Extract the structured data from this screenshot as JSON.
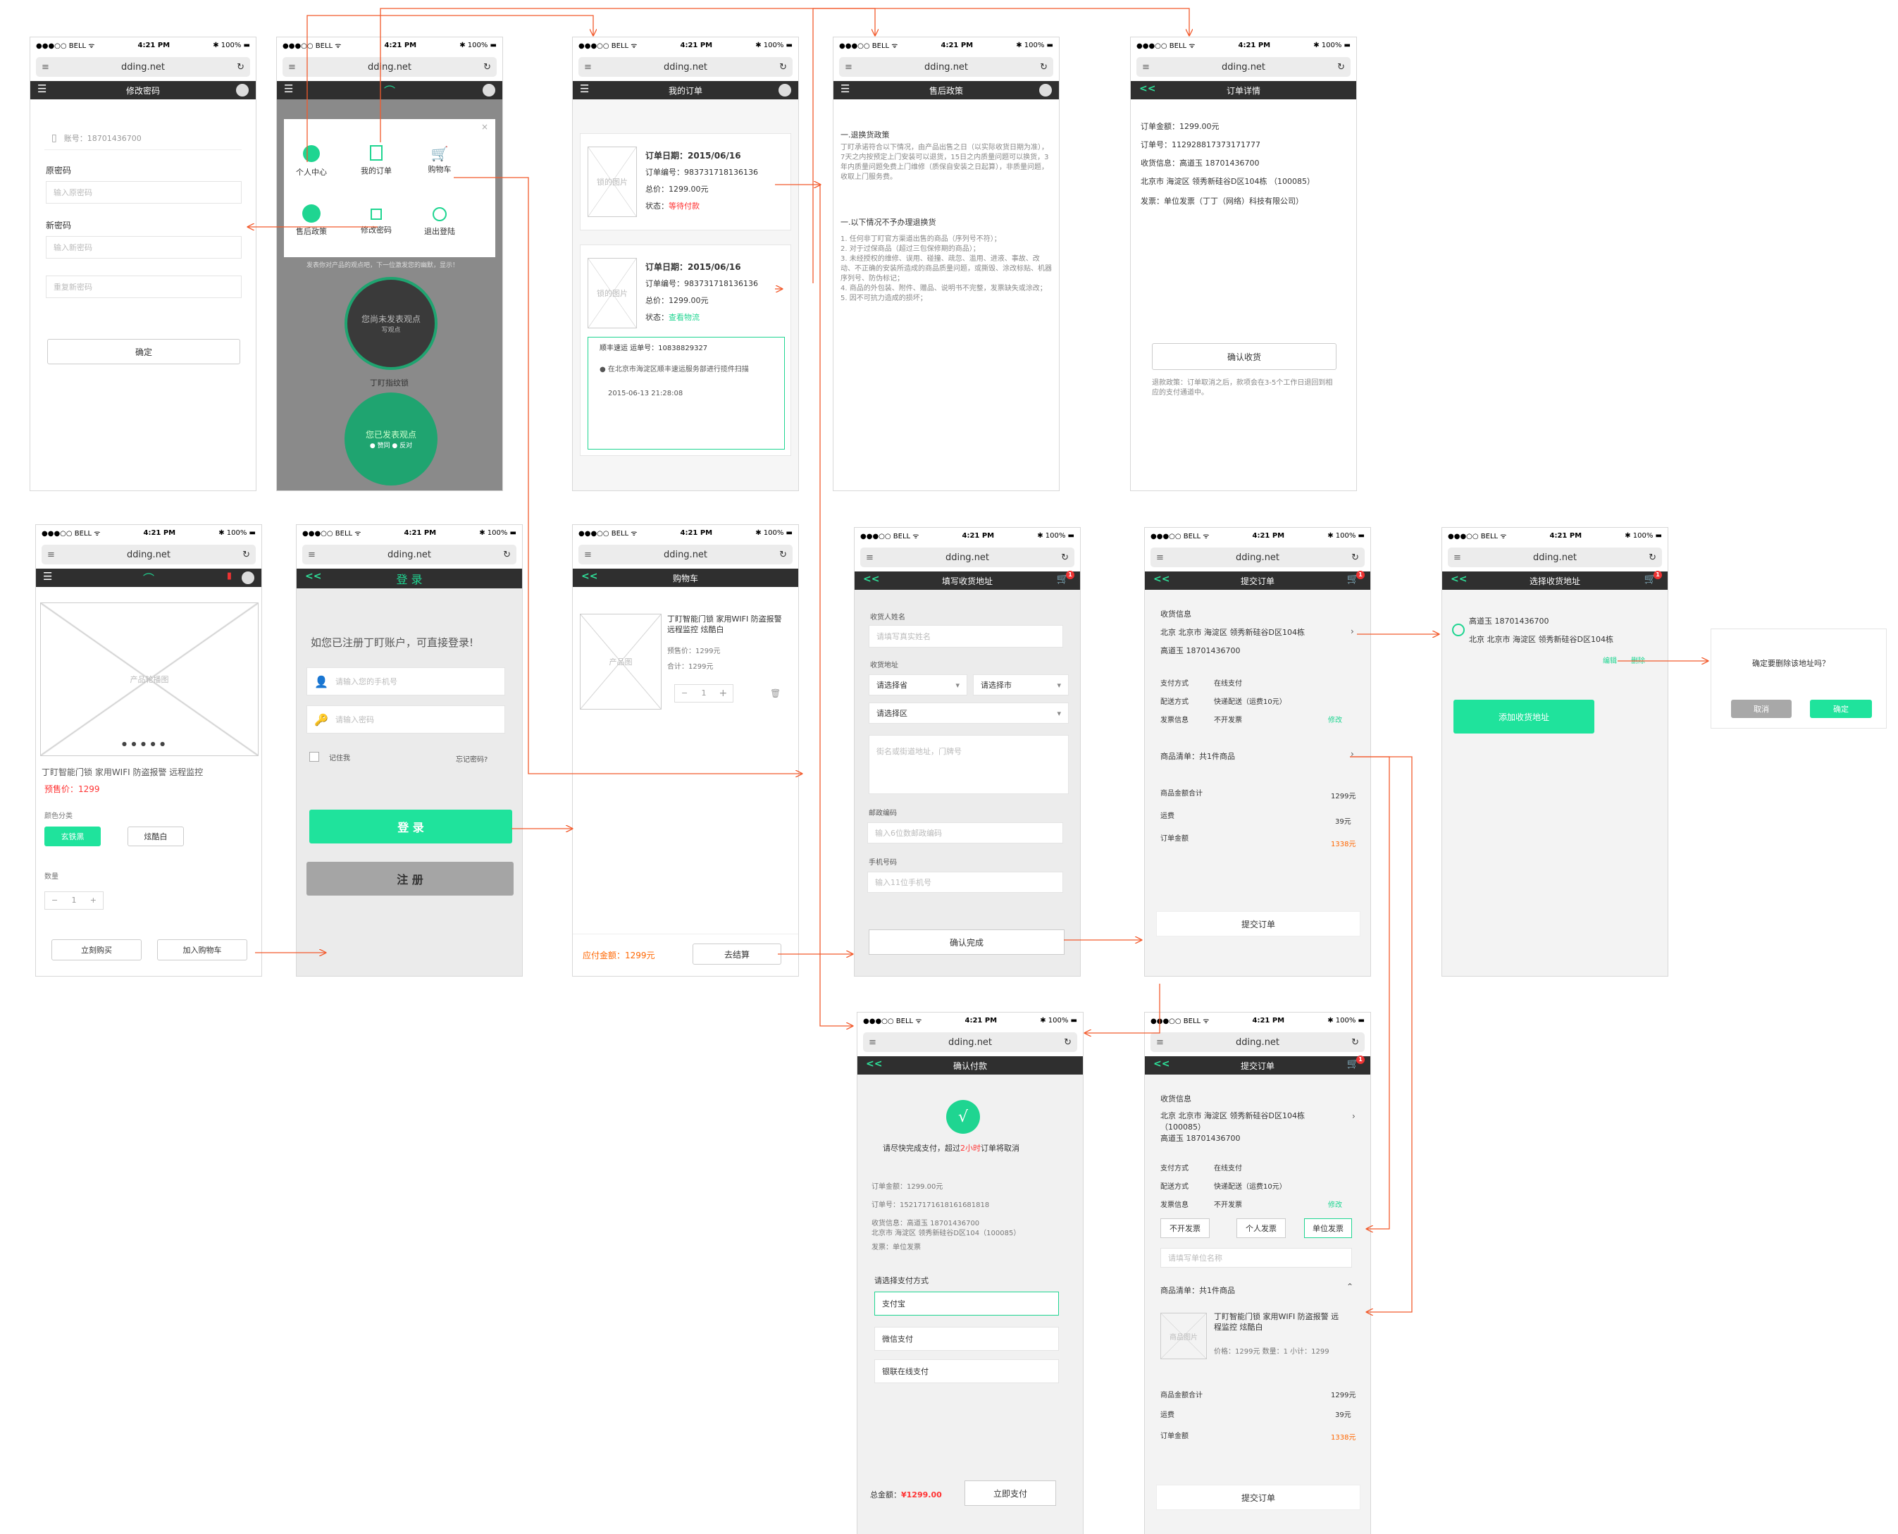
{
  "common": {
    "carrier": "●●●○○ BELL ᯤ",
    "time": "4:21 PM",
    "battery": "✱ 100% ▬",
    "url": "dding.net",
    "menu": "☰",
    "back": "<<",
    "cart_count": "1"
  },
  "s1": {
    "title": "修改密码",
    "account": "账号：18701436700",
    "old": "原密码",
    "old_ph": "输入原密码",
    "new": "新密码",
    "new_ph": "输入新密码",
    "repeat_ph": "重复新密码",
    "ok": "确定"
  },
  "s2": {
    "menu": [
      "个人中心",
      "我的订单",
      "购物车",
      "售后政策",
      "修改密码",
      "退出登陆"
    ],
    "close": "×",
    "note": "发表你对产品的观点吧，下一位激发您的幽默，显示！",
    "bubble1": "您尚未发表观点",
    "bubble1b": "写观点",
    "product": "丁盯指纹锁",
    "bubble2": "您已发表观点",
    "bubble2b": "● 赞同 ● 反对"
  },
  "s3": {
    "title": "我的订单",
    "o1_date": "订单日期：2015/06/16",
    "o1_no": "订单编号：983731718136136",
    "o1_total": "总价：1299.00元",
    "o1_status_l": "状态：",
    "o1_status": "等待付款",
    "img": "锁的图片",
    "o2_date": "订单日期：2015/06/16",
    "o2_no": "订单编号：983731718136136",
    "o2_total": "总价：1299.00元",
    "o2_status_l": "状态：",
    "o2_status": "查看物流",
    "ship": "顺丰速运  运单号：10838829327",
    "ship_msg": "● 在北京市海淀区顺丰速运服务部进行揽件扫描",
    "ship_time": "2015-06-13  21:28:08"
  },
  "s4": {
    "title": "售后政策",
    "h1": "一.退换货政策",
    "p1": "丁盯承诺符合以下情况，由产品出售之日（以实际收货日期为准），7天之内按预定上门安装可以退货，15日之内质量问题可以换货，3年内质量问题免费上门维修（质保自安装之日起算），非质量问题，收取上门服务费。",
    "h2": "一.以下情况不予办理退换货",
    "p2": "1. 任何非丁盯官方渠道出售的商品（序列号不符）；\n2. 对于过保商品（超过三包保修期的商品）；\n3. 未经授权的维修、误用、碰撞、疏忽、滥用、进液、事故、改动、不正确的安装所造成的商品质量问题，或撕毁、涂改标贴、机器序列号、防伪标记；\n4. 商品的外包装、附件、赠品、说明书不完整，发票缺失或涂改；\n5. 因不可抗力造成的损坏；"
  },
  "s5": {
    "title": "订单详情",
    "amount": "订单金额：1299.00元",
    "no": "订单号：112928817373171777",
    "recv": "收货信息：高道玉  18701436700",
    "addr": "北京市 海淀区 领秀新硅谷D区104栋 （100085）",
    "invoice": "发票：单位发票（丁丁（网络）科技有限公司）",
    "confirm": "确认收货",
    "refund": "退款政策：订单取消之后，款项会在3-5个工作日退回到相应的支付通道中。"
  },
  "s6": {
    "carousel": "产品轮播图",
    "dots": "● ● ● ● ●",
    "name": "丁盯智能门锁  家用WIFI  防盗报警 远程监控",
    "price": "预售价：1299",
    "color": "颜色分类",
    "c1": "玄铁黑",
    "c2": "炫酷白",
    "qty": "数量",
    "minus": "−",
    "one": "1",
    "plus": "+",
    "buy": "立刻购买",
    "add": "加入购物车"
  },
  "s7": {
    "title": "登  录",
    "tip": "如您已注册丁盯账户，可直接登录!",
    "phone_ph": "请输入您的手机号",
    "pwd_ph": "请输入密码",
    "remember": "记住我",
    "forgot": "忘记密码?",
    "login": "登  录",
    "register": "注  册"
  },
  "s8": {
    "title": "购物车",
    "img": "产品图",
    "name": "丁盯智能门锁  家用WIFI  防盗报警 远程监控   炫酷白",
    "pre": "预售价：1299元",
    "sum": "合计：1299元",
    "minus": "−",
    "one": "1",
    "plus": "+",
    "del": "🗑",
    "pay_l": "应付金额：1299元",
    "checkout": "去结算"
  },
  "s9": {
    "title": "填写收货地址",
    "name": "收货人姓名",
    "name_ph": "请填写真实姓名",
    "addr": "收货地址",
    "prov": "请选择省",
    "city": "请选择市",
    "dist": "请选择区",
    "street_ph": "街名或街道地址，门牌号",
    "zip": "邮政编码",
    "zip_ph": "输入6位数邮政编码",
    "phone": "手机号码",
    "phone_ph": "输入11位手机号",
    "done": "确认完成"
  },
  "s10": {
    "title": "提交订单",
    "recv": "收货信息",
    "addr": "北京 北京市 海淀区  领秀新硅谷D区104栋",
    "person": "高道玉   18701436700",
    "pay": "支付方式",
    "pay_v": "在线支付",
    "ship": "配送方式",
    "ship_v": "快递配送（运费10元）",
    "inv": "发票信息",
    "inv_v": "不开发票",
    "edit": "修改",
    "list": "商品清单：共1件商品",
    "goods": "商品金额合计",
    "goods_v": "1299元",
    "fee": "运费",
    "fee_v": "39元",
    "total": "订单金额",
    "total_v": "1338元",
    "submit": "提交订单"
  },
  "s11": {
    "title": "选择收货地址",
    "person": "高道玉    18701436700",
    "addr": "北京 北京市 海淀区 领秀新硅谷D区104栋",
    "edit": "编辑",
    "del": "删除",
    "add": "添加收货地址"
  },
  "dlg": {
    "q": "确定要删除该地址吗？",
    "cancel": "取消",
    "ok": "确定"
  },
  "s12": {
    "title": "确认付款",
    "check": "√",
    "tip_a": "请尽快完成支付，超过",
    "tip_b": "2小时",
    "tip_c": "订单将取消",
    "amount": "订单金额：1299.00元",
    "no": "订单号：15217171618161681818",
    "recv": "收货信息：高道玉 18701436700",
    "addr": "北京市 海淀区 领秀新硅谷D区104（100085）",
    "inv": "发票：单位发票",
    "choose": "请选择支付方式",
    "ali": "支付宝",
    "wx": "微信支付",
    "union": "银联在线支付",
    "total_l": "总金额：",
    "total_v": "¥1299.00",
    "pay": "立即支付"
  },
  "s13": {
    "title": "提交订单",
    "recv": "收货信息",
    "addr": "北京 北京市 海淀区  领秀新硅谷D区104栋",
    "zip": "（100085）",
    "person": "高道玉   18701436700",
    "pay": "支付方式",
    "pay_v": "在线支付",
    "ship": "配送方式",
    "ship_v": "快递配送（运费10元）",
    "inv": "发票信息",
    "inv_v": "不开发票",
    "edit": "修改",
    "o1": "不开发票",
    "o2": "个人发票",
    "o3": "单位发票",
    "company_ph": "请填写单位名称",
    "list": "商品清单：共1件商品",
    "img": "商品图片",
    "name": "丁盯智能门锁  家用WIFI  防盗报警 远程监控   炫酷白",
    "meta": "价格：1299元  数量：1  小计：1299",
    "goods": "商品金额合计",
    "goods_v": "1299元",
    "fee": "运费",
    "fee_v": "39元",
    "total": "订单金额",
    "total_v": "1338元",
    "submit": "提交订单"
  }
}
